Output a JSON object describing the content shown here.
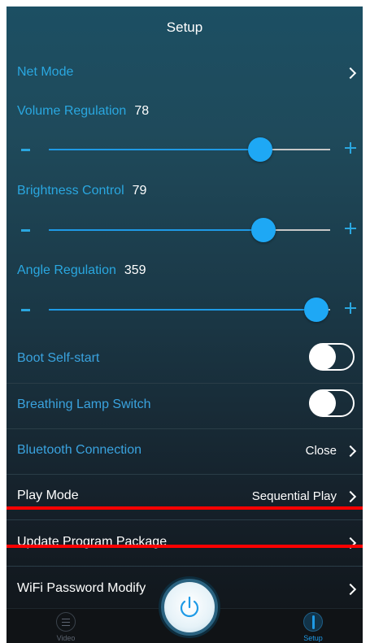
{
  "header": {
    "title": "Setup"
  },
  "rows": {
    "net_mode": {
      "label": "Net Mode"
    },
    "volume": {
      "label": "Volume Regulation",
      "value": "78",
      "level": 0.78
    },
    "brightness": {
      "label": "Brightness Control",
      "value": "79",
      "level": 0.79
    },
    "angle": {
      "label": "Angle Regulation",
      "value": "359",
      "level": 1.0
    },
    "boot_self_start": {
      "label": "Boot Self-start",
      "on": false
    },
    "breathing_lamp": {
      "label": "Breathing Lamp Switch",
      "on": false
    },
    "bluetooth": {
      "label": "Bluetooth Connection",
      "value": "Close"
    },
    "play_mode": {
      "label": "Play Mode",
      "value": "Sequential Play"
    },
    "update": {
      "label": "Update Program Package"
    },
    "wifi": {
      "label": "WiFi Password Modify"
    }
  },
  "slider_symbols": {
    "minus": "−",
    "plus": "+"
  },
  "tabbar": {
    "video_label": "Video",
    "setup_label": "Setup"
  },
  "colors": {
    "accent": "#1ea8f5",
    "highlight": "#ff0000",
    "label_blue": "#2aa7e0"
  },
  "icons": [
    "chevron-right-icon",
    "power-icon",
    "video-list-icon",
    "setup-compass-icon"
  ]
}
